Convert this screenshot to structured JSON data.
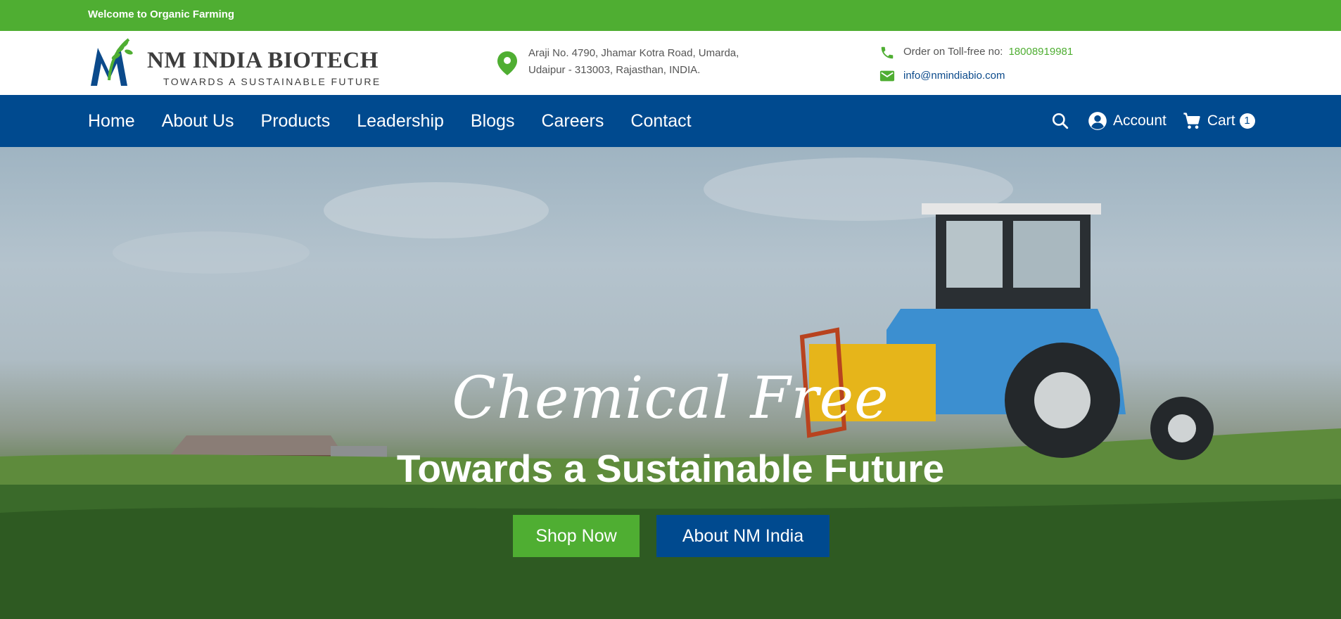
{
  "topbar": {
    "welcome": "Welcome to Organic Farming"
  },
  "header": {
    "logo": {
      "brand": "NM INDIA BIOTECH",
      "tagline": "TOWARDS A SUSTAINABLE FUTURE"
    },
    "address": {
      "line1": "Araji No. 4790, Jhamar Kotra Road, Umarda,",
      "line2": "Udaipur - 313003, Rajasthan, INDIA."
    },
    "contact": {
      "phone_label": "Order on Toll-free no:",
      "phone_number": "18008919981",
      "email": "info@nmindiabio.com"
    }
  },
  "nav": {
    "items": [
      {
        "label": "Home"
      },
      {
        "label": "About Us"
      },
      {
        "label": "Products"
      },
      {
        "label": "Leadership"
      },
      {
        "label": "Blogs"
      },
      {
        "label": "Careers"
      },
      {
        "label": "Contact"
      }
    ],
    "account_label": "Account",
    "cart_label": "Cart",
    "cart_count": "1"
  },
  "hero": {
    "script_title": "Chemical Free",
    "headline": "Towards a Sustainable Future",
    "shop_button": "Shop Now",
    "about_button": "About NM India"
  },
  "icons": {
    "location": "location-pin-icon",
    "phone": "phone-icon",
    "mail": "mail-icon",
    "search": "search-icon",
    "account": "account-circle-icon",
    "cart": "cart-icon"
  },
  "colors": {
    "green": "#4fae32",
    "blue": "#004a8f",
    "link_blue": "#0b4a8b"
  }
}
